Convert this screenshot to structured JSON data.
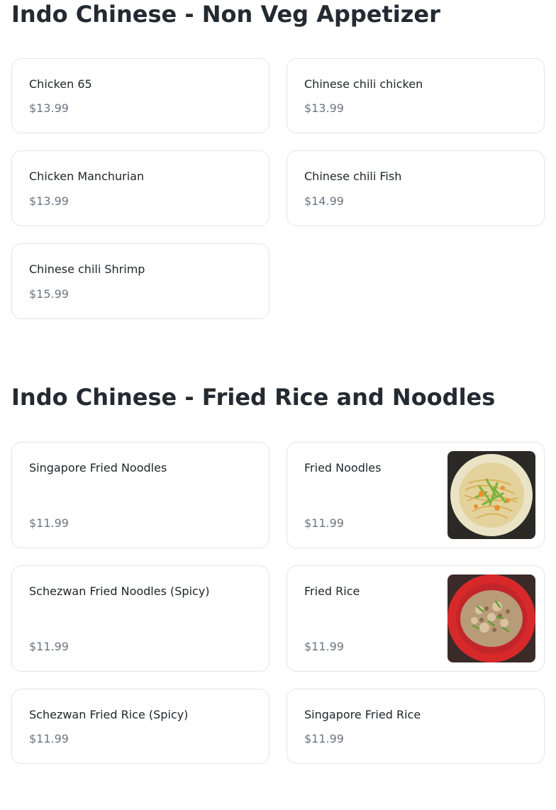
{
  "sections": [
    {
      "title": "Indo Chinese - Non Veg Appetizer",
      "items": [
        {
          "name": "Chicken 65",
          "price": "$13.99"
        },
        {
          "name": "Chinese chili chicken",
          "price": "$13.99"
        },
        {
          "name": "Chicken Manchurian",
          "price": "$13.99"
        },
        {
          "name": "Chinese chili Fish",
          "price": "$14.99"
        },
        {
          "name": "Chinese chili Shrimp",
          "price": "$15.99"
        }
      ]
    },
    {
      "title": "Indo Chinese - Fried Rice and Noodles",
      "items": [
        {
          "name": "Singapore Fried Noodles",
          "price": "$11.99"
        },
        {
          "name": "Fried Noodles",
          "price": "$11.99",
          "image": "fried-noodles-photo"
        },
        {
          "name": "Schezwan Fried Noodles (Spicy)",
          "price": "$11.99"
        },
        {
          "name": "Fried Rice",
          "price": "$11.99",
          "image": "fried-rice-photo"
        },
        {
          "name": "Schezwan Fried Rice (Spicy)",
          "price": "$11.99"
        },
        {
          "name": "Singapore Fried Rice",
          "price": "$11.99"
        }
      ]
    }
  ]
}
